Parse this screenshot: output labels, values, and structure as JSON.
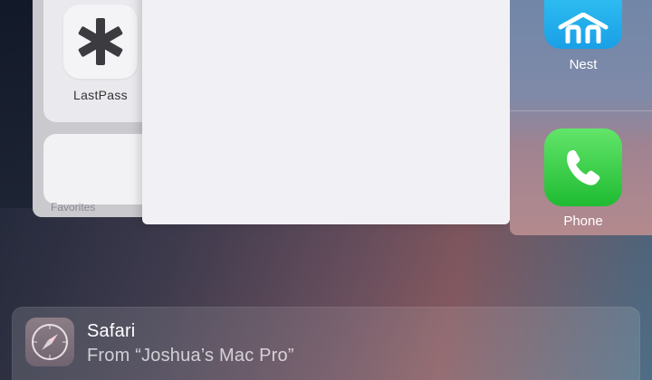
{
  "apps": {
    "lastpass": {
      "label": "LastPass",
      "icon": "lastpass-asterisk-icon"
    },
    "favorites": {
      "label": "Favorites"
    },
    "nest": {
      "label": "Nest",
      "icon": "nest-house-icon",
      "color": "#1a9fe6"
    },
    "phone": {
      "label": "Phone",
      "icon": "phone-handset-icon",
      "color": "#1fbb32"
    }
  },
  "handoff": {
    "app_name": "Safari",
    "source": "From “Joshua’s Mac Pro”",
    "icon": "safari-compass-icon"
  }
}
